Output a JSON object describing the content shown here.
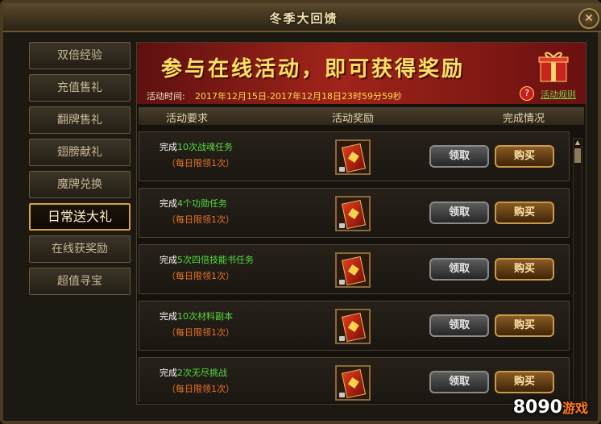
{
  "window": {
    "title": "冬季大回馈",
    "close": "✕"
  },
  "sidebar": {
    "items": [
      {
        "label": "双倍经验",
        "active": false
      },
      {
        "label": "充值售礼",
        "active": false
      },
      {
        "label": "翻牌售礼",
        "active": false
      },
      {
        "label": "翅膀献礼",
        "active": false
      },
      {
        "label": "魔牌兑换",
        "active": false
      },
      {
        "label": "日常送大礼",
        "active": true
      },
      {
        "label": "在线获奖励",
        "active": false
      },
      {
        "label": "超值寻宝",
        "active": false
      }
    ]
  },
  "banner": {
    "headline": "参与在线活动，即可获得奖励",
    "time_label": "活动时间:",
    "time_value": "2017年12月15日-2017年12月18日23时59分59秒",
    "rules_label": "活动规则",
    "rules_icon": "?"
  },
  "columns": {
    "requirement": "活动要求",
    "reward": "活动奖励",
    "status": "完成情况"
  },
  "tasks": [
    {
      "prefix": "完成",
      "highlight": "10次战魂任务",
      "limit": "（每日限领1次）",
      "claim": "领取",
      "buy": "购买"
    },
    {
      "prefix": "完成",
      "highlight": "4个功勋任务",
      "limit": "（每日限领1次）",
      "claim": "领取",
      "buy": "购买"
    },
    {
      "prefix": "完成",
      "highlight": "5次四倍技能书任务",
      "limit": "（每日限领1次）",
      "claim": "领取",
      "buy": "购买"
    },
    {
      "prefix": "完成",
      "highlight": "10次材料副本",
      "limit": "（每日限领1次）",
      "claim": "领取",
      "buy": "购买"
    },
    {
      "prefix": "完成",
      "highlight": "2次无尽挑战",
      "limit": "（每日限领1次）",
      "claim": "领取",
      "buy": "购买"
    }
  ],
  "watermark": {
    "brand": "8090",
    "suffix": "游戏"
  }
}
